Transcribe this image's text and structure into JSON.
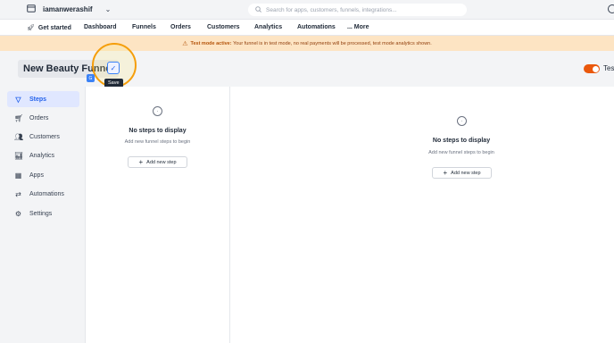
{
  "topbar": {
    "store_name": "iamanwerashif",
    "search_placeholder": "Search for apps, customers, funnels, integrations..."
  },
  "nav": {
    "get_started": "Get started",
    "dashboard": "Dashboard",
    "funnels": "Funnels",
    "orders": "Orders",
    "customers": "Customers",
    "analytics": "Analytics",
    "automations": "Automations",
    "more": "... More"
  },
  "banner": {
    "lead": "Test mode active:",
    "text": "Your funnel is in test mode, no real payments will be processed, test mode analytics shown."
  },
  "header": {
    "funnel_name": "New Beauty Funnel",
    "save_tooltip": "Save",
    "toggle_label": "Tes",
    "toggle_color": "#ea580c"
  },
  "sidebar": {
    "items": [
      {
        "label": "Steps",
        "icon": "filter-icon"
      },
      {
        "label": "Orders",
        "icon": "cart-icon"
      },
      {
        "label": "Customers",
        "icon": "users-icon"
      },
      {
        "label": "Analytics",
        "icon": "chart-icon"
      },
      {
        "label": "Apps",
        "icon": "apps-grid-icon"
      },
      {
        "label": "Automations",
        "icon": "automation-icon"
      },
      {
        "label": "Settings",
        "icon": "gear-icon"
      }
    ]
  },
  "steps_panel": {
    "empty_title": "No steps to display",
    "empty_sub": "Add new funnel steps to begin",
    "add_label": "Add new step"
  },
  "main_panel": {
    "empty_title": "No steps to display",
    "empty_sub": "Add new funnel steps to begin",
    "add_label": "Add new step"
  },
  "colors": {
    "accent": "#2563eb",
    "highlight": "#f59e0b",
    "banner_bg": "#fde4c3"
  }
}
